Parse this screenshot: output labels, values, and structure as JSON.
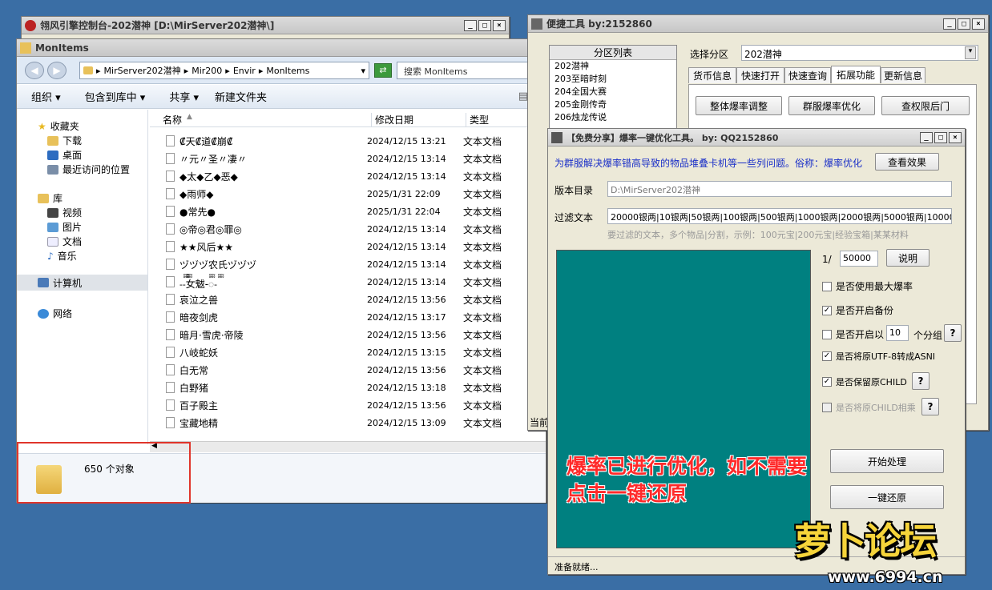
{
  "console_window": {
    "title": "翎风引擎控制台-202潜神 [D:\\MirServer202潜神\\]"
  },
  "explorer": {
    "title": "MonItems",
    "breadcrumb": [
      "MirServer202潜神",
      "Mir200",
      "Envir",
      "MonItems"
    ],
    "search_placeholder": "搜索 MonItems",
    "toolbar": {
      "organize": "组织 ▾",
      "include_in_library": "包含到库中 ▾",
      "share": "共享 ▾",
      "new_folder": "新建文件夹"
    },
    "nav": {
      "favorites": "收藏夹",
      "downloads": "下载",
      "desktop": "桌面",
      "recent": "最近访问的位置",
      "libraries": "库",
      "videos": "视频",
      "pictures": "图片",
      "documents": "文档",
      "music": "音乐",
      "computer": "计算机",
      "network": "网络"
    },
    "columns": {
      "name": "名称",
      "modified": "修改日期",
      "type": "类型"
    },
    "files": [
      {
        "name": "₡天₡道₡崩₡",
        "date": "2024/12/15 13:21",
        "type": "文本文档"
      },
      {
        "name": "〃元〃圣〃凄〃",
        "date": "2024/12/15 13:14",
        "type": "文本文档"
      },
      {
        "name": "◆太◆乙◆恶◆",
        "date": "2024/12/15 13:14",
        "type": "文本文档"
      },
      {
        "name": "◆雨师◆",
        "date": "2025/1/31 22:09",
        "type": "文本文档"
      },
      {
        "name": "●常先●",
        "date": "2025/1/31 22:04",
        "type": "文本文档"
      },
      {
        "name": "◎帝◎君◎罪◎",
        "date": "2024/12/15 13:14",
        "type": "文本文档"
      },
      {
        "name": "★★风后★★",
        "date": "2024/12/15 13:14",
        "type": "文本文档"
      },
      {
        "name": "ヅヅヅ农氏ヅヅヅ",
        "date": "2024/12/15 13:14",
        "type": "文本文档"
      },
      {
        "name": "-ᢆ-ᢆ女魃-ᢆ-ᢆ",
        "date": "2024/12/15 13:14",
        "type": "文本文档"
      },
      {
        "name": "哀泣之兽",
        "date": "2024/12/15 13:56",
        "type": "文本文档"
      },
      {
        "name": "暗夜剑虎",
        "date": "2024/12/15 13:17",
        "type": "文本文档"
      },
      {
        "name": "暗月·雪虎·帝陵",
        "date": "2024/12/15 13:56",
        "type": "文本文档"
      },
      {
        "name": "八岐蛇妖",
        "date": "2024/12/15 13:15",
        "type": "文本文档"
      },
      {
        "name": "白无常",
        "date": "2024/12/15 13:56",
        "type": "文本文档"
      },
      {
        "name": "白野猪",
        "date": "2024/12/15 13:18",
        "type": "文本文档"
      },
      {
        "name": "百子殿主",
        "date": "2024/12/15 13:56",
        "type": "文本文档"
      },
      {
        "name": "宝藏地精",
        "date": "2024/12/15 13:09",
        "type": "文本文档"
      }
    ],
    "status_count": "650 个对象"
  },
  "quick_tool": {
    "title": "便捷工具  by:2152860",
    "partition_header": "分区列表",
    "partitions": [
      "202潜神",
      "203至暗时刻",
      "204全国大赛",
      "205金刚传奇",
      "206烛龙传说"
    ],
    "select_label": "选择分区",
    "selected_partition": "202潜神",
    "tabs": [
      "货币信息",
      "快速打开",
      "快速查询",
      "拓展功能",
      "更新信息"
    ],
    "buttons": {
      "rate_adjust": "整体爆率调整",
      "group_opt": "群服爆率优化",
      "backdoor": "查权限后门"
    },
    "status_prefix": "当前"
  },
  "optimizer": {
    "title": "【免费分享】爆率一键优化工具。     by: QQ2152860",
    "desc": "为群服解决爆率错高导致的物品堆叠卡机等一些列问题。俗称：爆率优化",
    "view_effect": "查看效果",
    "version_dir_label": "版本目录",
    "version_dir": "D:\\MirServer202潜神",
    "filter_label": "过滤文本",
    "filter_value": "20000银两|10银两|50银两|100银两|500银两|1000银两|2000银两|5000银两|10000",
    "filter_hint": "要过滤的文本，多个物品|分割，示例：100元宝|200元宝|经验宝箱|某某材料",
    "ratio_prefix": "1/",
    "ratio_value": "50000",
    "explain": "说明",
    "options": {
      "max_rate": "是否使用最大爆率",
      "backup": "是否开启备份",
      "group_prefix": "是否开启以",
      "group_value": "10",
      "group_suffix": "个分组",
      "utf8": "是否将原UTF-8转成ASNI",
      "keep_child": "是否保留原CHILD",
      "child_multiply": "是否将原CHILD相乘"
    },
    "help": "?",
    "start": "开始处理",
    "restore": "一键还原",
    "overlay_text": [
      "爆率已进行优化，如不需要",
      "点击一键还原"
    ],
    "status": "准备就绪..."
  },
  "watermark": {
    "logo": "萝卜论坛",
    "url": "www.6994.cn"
  },
  "colors": {
    "desktop": "#3a6ea5",
    "teal": "#008080",
    "highlight_red": "#ff2a2a",
    "annotation_box": "#e0352b"
  }
}
